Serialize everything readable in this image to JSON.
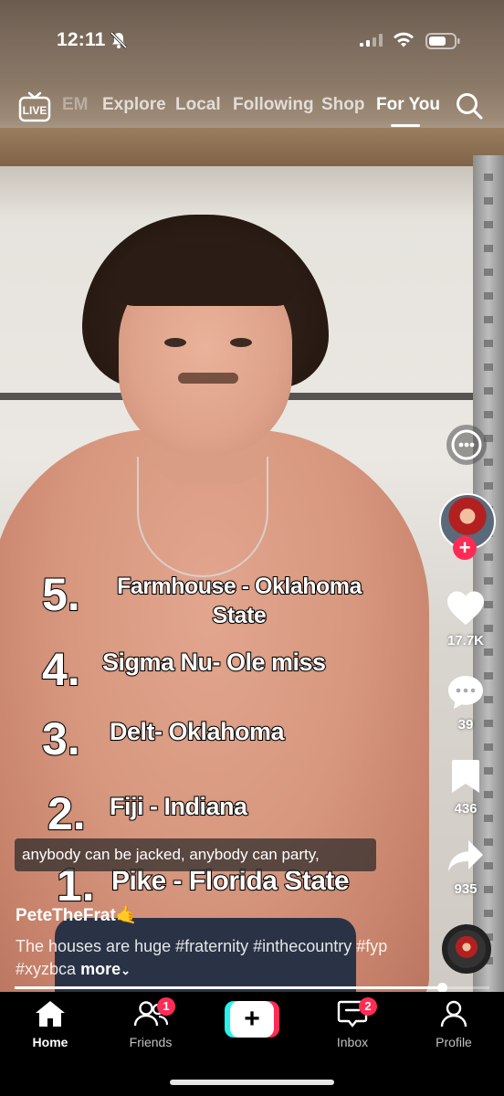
{
  "status_bar": {
    "time": "12:11",
    "icons": [
      "bell-off-icon",
      "signal-icon",
      "wifi-icon",
      "battery-icon"
    ]
  },
  "top_nav": {
    "live_label": "LIVE",
    "partial_tab": "EM",
    "tabs": [
      "Explore",
      "Local",
      "Following",
      "Shop",
      "For You"
    ],
    "active_tab": "For You"
  },
  "overlay": {
    "ranks": [
      {
        "number": "5.",
        "text": "Farmhouse - Oklahoma State"
      },
      {
        "number": "4.",
        "text": "Sigma Nu- Ole miss"
      },
      {
        "number": "3.",
        "text": "Delt- Oklahoma"
      },
      {
        "number": "2.",
        "text": "Fiji - Indiana"
      },
      {
        "number": "1.",
        "text": "Pike - Florida State"
      }
    ],
    "caption": "anybody can be jacked, anybody can party,"
  },
  "actions": {
    "likes": "17.7K",
    "comments": "39",
    "bookmarks": "436",
    "shares": "935"
  },
  "video": {
    "creator": "PeteTheFrat🤙",
    "description": "The houses are huge #fraternity #inthecountry #fyp #xyzbca",
    "more_label": "more",
    "progress": 0.9
  },
  "bottom_nav": {
    "home": "Home",
    "friends": "Friends",
    "friends_badge": "1",
    "inbox": "Inbox",
    "inbox_badge": "2",
    "profile": "Profile",
    "create_symbol": "+"
  },
  "colors": {
    "accent_red": "#fe2c55",
    "accent_cyan": "#25f4ee"
  }
}
